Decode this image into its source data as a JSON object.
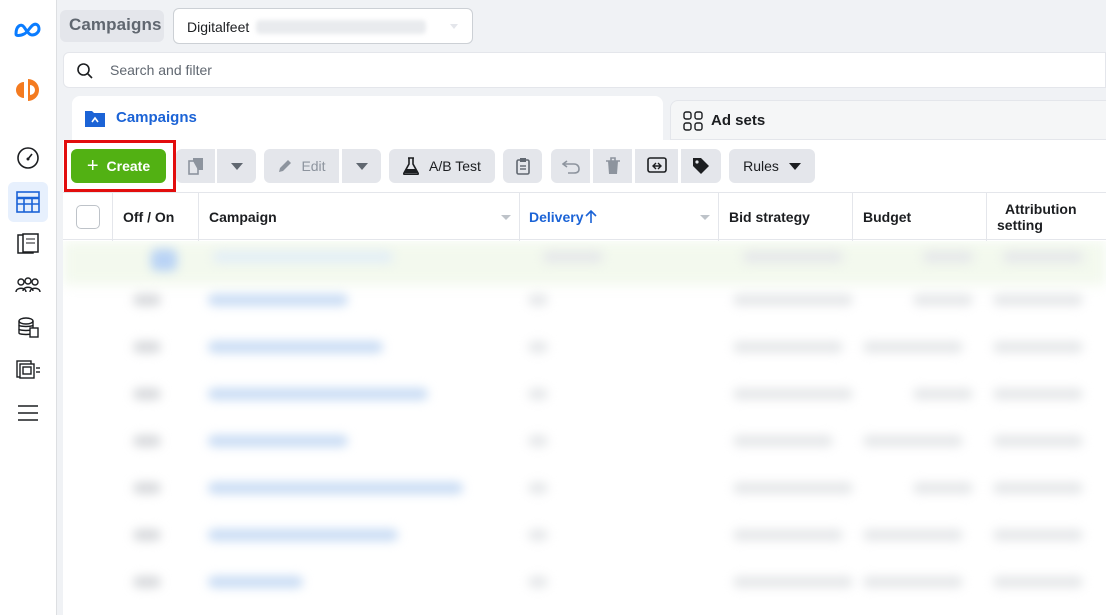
{
  "topbar": {
    "page_title": "Campaigns",
    "account_name": "Digitalfeet"
  },
  "search": {
    "placeholder": "Search and filter"
  },
  "tabs": [
    {
      "label": "Campaigns",
      "active": true
    },
    {
      "label": "Ad sets",
      "active": false
    }
  ],
  "toolbar": {
    "create_label": "Create",
    "edit_label": "Edit",
    "ab_test_label": "A/B Test",
    "rules_label": "Rules"
  },
  "table": {
    "columns": [
      "Off / On",
      "Campaign",
      "Delivery",
      "Bid strategy",
      "Budget",
      "Attribution setting"
    ],
    "sorted_column": "Delivery",
    "sort_direction": "ascending",
    "attribution_line1": "Attribution",
    "attribution_line2": "setting"
  },
  "colors": {
    "brand_blue": "#1b63d6",
    "create_green": "#52b113",
    "highlight_red": "#e20d0d"
  },
  "rail_icons": [
    "meta-logo-icon",
    "business-logo-icon",
    "dashboard-gauge-icon",
    "ads-manager-table-icon",
    "pages-icon",
    "audiences-icon",
    "billing-icon",
    "catalog-icon",
    "all-tools-menu-icon"
  ]
}
